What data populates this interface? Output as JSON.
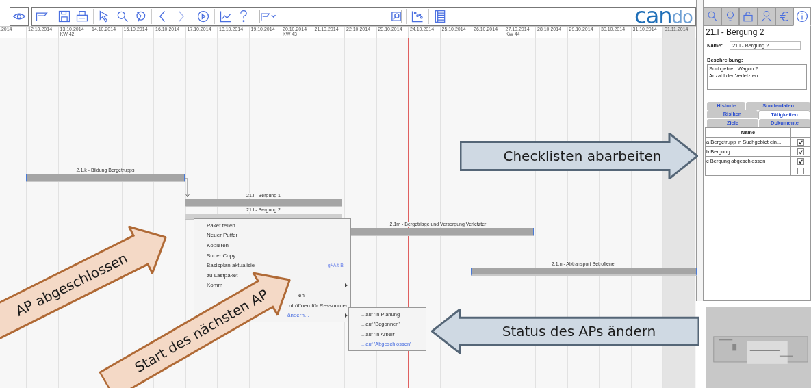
{
  "toolbar": {
    "logo": [
      "can",
      "do"
    ]
  },
  "timeline": {
    "lead": ".2014",
    "days": [
      {
        "date": "12.10.2014"
      },
      {
        "date": "13.10.2014",
        "week": "KW 42"
      },
      {
        "date": "14.10.2014"
      },
      {
        "date": "15.10.2014"
      },
      {
        "date": "16.10.2014"
      },
      {
        "date": "17.10.2014"
      },
      {
        "date": "18.10.2014"
      },
      {
        "date": "19.10.2014"
      },
      {
        "date": "20.10.2014",
        "week": "KW 43"
      },
      {
        "date": "21.10.2014"
      },
      {
        "date": "22.10.2014"
      },
      {
        "date": "23.10.2014"
      },
      {
        "date": "24.10.2014"
      },
      {
        "date": "25.10.2014"
      },
      {
        "date": "26.10.2014"
      },
      {
        "date": "27.10.2014",
        "week": "KW 44"
      },
      {
        "date": "28.10.2014"
      },
      {
        "date": "29.10.2014"
      },
      {
        "date": "30.10.2014"
      },
      {
        "date": "31.10.2014"
      },
      {
        "date": "01.11.2014"
      }
    ]
  },
  "bars": [
    {
      "label": "2.1.k - Bildung Bergetrupps",
      "selected": false
    },
    {
      "label": "21.l - Bergung 1",
      "selected": false
    },
    {
      "label": "21.l - Bergung 2",
      "selected": true
    },
    {
      "label": "2.1m - Bergetriage und Versorgung Verletzter",
      "selected": false
    },
    {
      "label": "2.1.n - Abtransport Betroffener",
      "selected": false
    }
  ],
  "context_menu": {
    "items": [
      {
        "label": "Paket teilen",
        "kind": "item"
      },
      {
        "label": "Neuer Puffer",
        "kind": "item"
      },
      {
        "label": "Kopieren",
        "kind": "item"
      },
      {
        "label": "Super Copy",
        "kind": "item"
      },
      {
        "label": "Basisplan aktualisie",
        "shortcut": "g+Alt-B",
        "kind": "item"
      },
      {
        "label": "zu Lastpaket",
        "kind": "item"
      },
      {
        "label": "Komm",
        "kind": "submenu"
      },
      {
        "label": "en",
        "kind": "cut"
      },
      {
        "label": "nt öffnen für Ressourcen",
        "kind": "cut"
      },
      {
        "label": "ändern...",
        "kind": "open"
      }
    ],
    "submenu": [
      {
        "label": "...auf 'In Planung'",
        "selected": false
      },
      {
        "label": "...auf 'Begonnen'",
        "selected": false
      },
      {
        "label": "...auf 'In Arbeit'",
        "selected": false
      },
      {
        "label": "...auf 'Abgeschlossen'",
        "selected": true
      }
    ]
  },
  "panel": {
    "tabs": [
      {
        "kind": "search",
        "selected": false
      },
      {
        "kind": "bulb",
        "selected": false
      },
      {
        "kind": "lock",
        "selected": false
      },
      {
        "kind": "person",
        "selected": false
      },
      {
        "kind": "euro",
        "selected": false
      },
      {
        "kind": "info",
        "selected": true
      }
    ],
    "title": "21.l - Bergung 2",
    "name_label": "Name:",
    "name_value": "21.l - Bergung 2",
    "description_label": "Beschreibung:",
    "description": [
      "Suchgebiet: Wagon 2",
      "Anzahl der Verletzten:"
    ],
    "detail_tabs": [
      [
        {
          "label": "Historie",
          "selected": false
        },
        {
          "label": "Sonderdaten",
          "selected": false
        }
      ],
      [
        {
          "label": "Risiken",
          "selected": false
        },
        {
          "label": "Tätigkeiten",
          "selected": true
        }
      ],
      [
        {
          "label": "Ziele",
          "selected": false
        },
        {
          "label": "Dokumente",
          "selected": false
        }
      ]
    ],
    "table": {
      "columns": [
        "Name"
      ],
      "rows": [
        {
          "name": "a Bergetrupp in Suchgebiet ein...",
          "checked": true
        },
        {
          "name": "b Bergung",
          "checked": true
        },
        {
          "name": "c Bergung abgeschlossen",
          "checked": true
        },
        {
          "checked": false
        }
      ]
    }
  },
  "callouts": [
    {
      "text": "AP abgeschlossen",
      "kind": "orange"
    },
    {
      "text": "Start des nächsten AP",
      "kind": "orange"
    },
    {
      "text": "Checklisten abarbeiten",
      "kind": "blue"
    },
    {
      "text": "Status des APs ändern",
      "kind": "blue"
    }
  ]
}
